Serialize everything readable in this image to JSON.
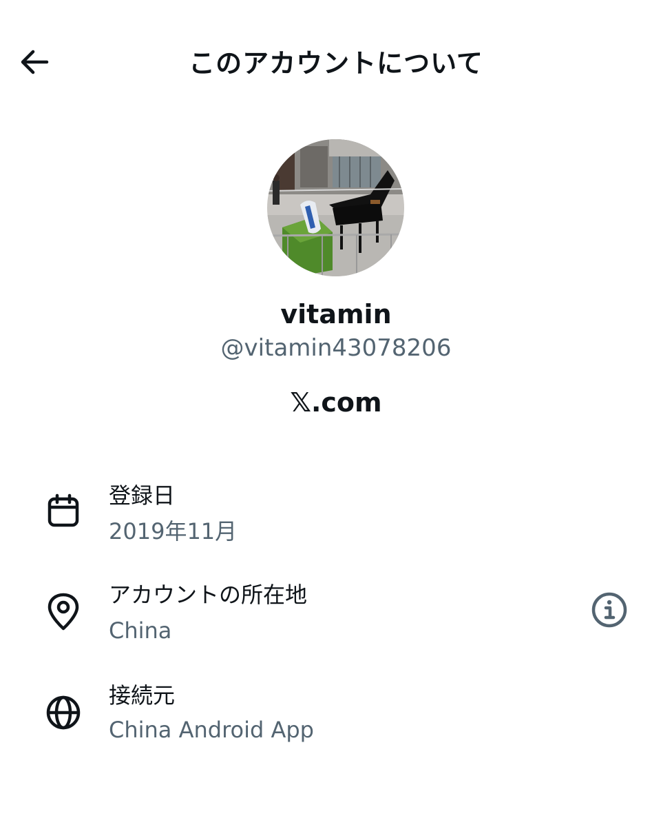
{
  "header": {
    "title": "このアカウントについて",
    "back_icon": "arrow-left-icon"
  },
  "profile": {
    "display_name": "vitamin",
    "handle": "@vitamin43078206",
    "domain": "𝕏.com"
  },
  "details": [
    {
      "icon": "calendar-icon",
      "label": "登録日",
      "value": "2019年11月"
    },
    {
      "icon": "location-pin-icon",
      "label": "アカウントの所在地",
      "value": "China",
      "trailing_icon": "info-icon"
    },
    {
      "icon": "globe-icon",
      "label": "接続元",
      "value": "China Android App"
    }
  ],
  "colors": {
    "text_primary": "#0f1419",
    "text_secondary": "#536471",
    "background": "#ffffff"
  }
}
